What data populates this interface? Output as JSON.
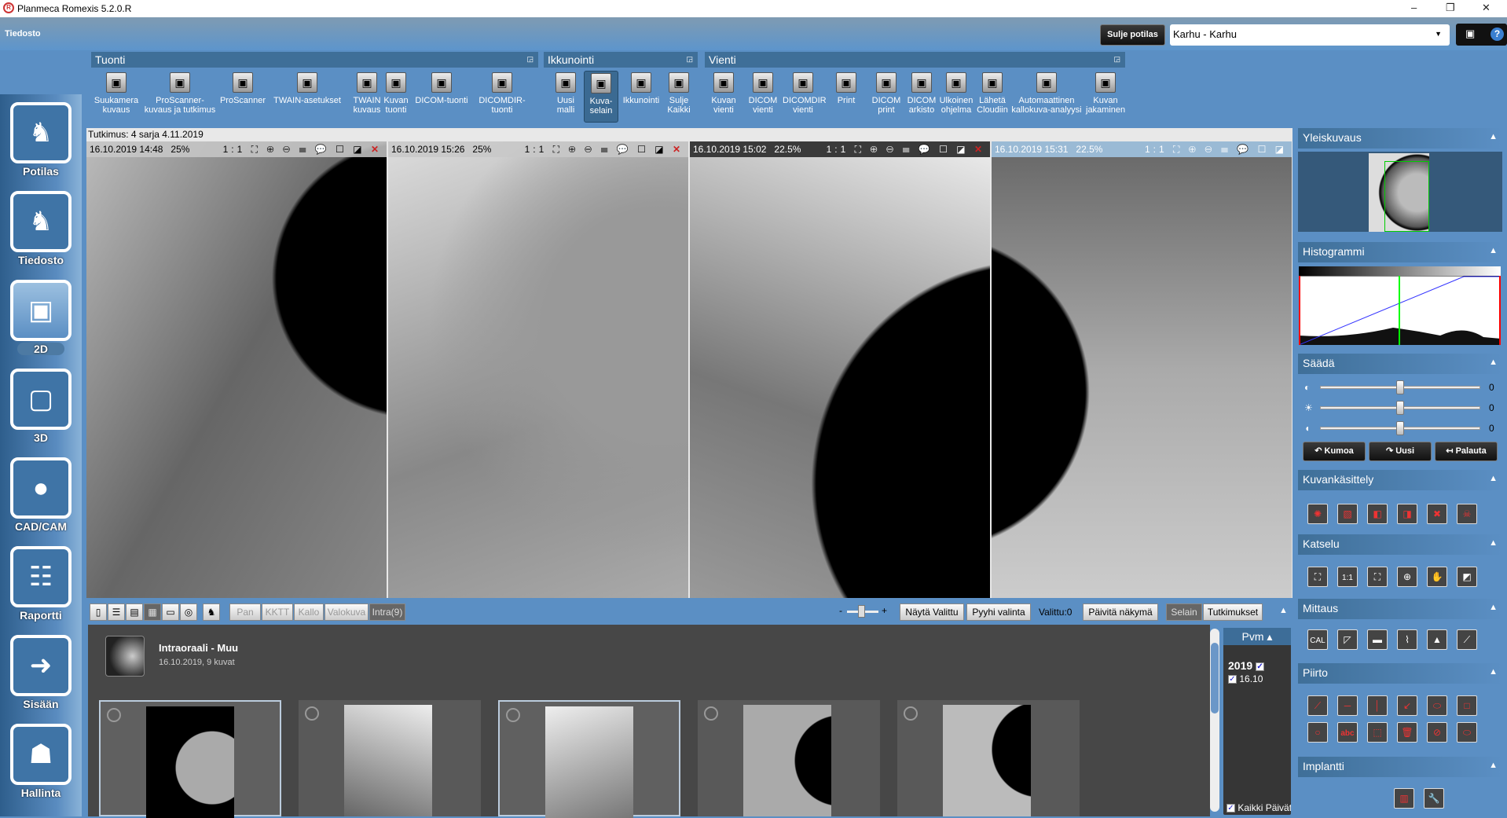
{
  "window": {
    "title": "Planmeca Romexis 5.2.0.R",
    "controls": [
      "–",
      "❐",
      "✕"
    ]
  },
  "menu": {
    "file": "Tiedosto"
  },
  "header": {
    "close_patient": "Sulje potilas",
    "patient": "Karhu - Karhu"
  },
  "ribbon": {
    "groups": [
      {
        "title": "Tuonti"
      },
      {
        "title": "Ikkunointi"
      },
      {
        "title": "Vienti"
      }
    ],
    "buttons": [
      {
        "label": "Suukamera kuvaus",
        "icon": "intraoral-camera-icon"
      },
      {
        "label": "ProScanner-kuvaus ja tutkimus",
        "icon": "scanner-icon"
      },
      {
        "label": "ProScanner",
        "icon": "scanner-icon"
      },
      {
        "label": "TWAIN-asetukset",
        "icon": "twain-settings-icon"
      },
      {
        "label": "TWAIN kuvaus",
        "icon": "twain-icon"
      },
      {
        "label": "Kuvan tuonti",
        "icon": "import-icon"
      },
      {
        "label": "DICOM-tuonti",
        "icon": "dicom-import-icon"
      },
      {
        "label": "DICOMDIR-tuonti",
        "icon": "dicomdir-import-icon"
      },
      {
        "label": "Uusi malli",
        "icon": "new-layout-icon"
      },
      {
        "label": "Kuva-selain",
        "icon": "image-browser-icon",
        "selected": true
      },
      {
        "label": "Ikkunointi",
        "icon": "windowing-icon"
      },
      {
        "label": "Sulje Kaikki",
        "icon": "close-all-icon"
      },
      {
        "label": "Kuvan vienti",
        "icon": "export-icon"
      },
      {
        "label": "DICOM vienti",
        "icon": "dicom-export-icon"
      },
      {
        "label": "DICOMDIR vienti",
        "icon": "dicomdir-export-icon"
      },
      {
        "label": "Print",
        "icon": "print-icon"
      },
      {
        "label": "DICOM print",
        "icon": "dicom-print-icon"
      },
      {
        "label": "DICOM arkisto",
        "icon": "dicom-archive-icon"
      },
      {
        "label": "Ulkoinen ohjelma",
        "icon": "external-program-icon"
      },
      {
        "label": "Lähetä Cloudiin",
        "icon": "cloud-upload-icon"
      },
      {
        "label": "Automaattinen kallokuva-analyysi",
        "icon": "ceph-analysis-icon"
      },
      {
        "label": "Kuvan jakaminen",
        "icon": "share-icon"
      }
    ]
  },
  "sidebar": {
    "items": [
      {
        "label": "Potilas"
      },
      {
        "label": "Tiedosto"
      },
      {
        "label": "2D",
        "active": true
      },
      {
        "label": "3D"
      },
      {
        "label": "CAD/CAM"
      },
      {
        "label": "Raportti"
      },
      {
        "label": "Sisään"
      },
      {
        "label": "Hallinta"
      }
    ]
  },
  "study": {
    "label": "Tutkimus: 4 sarja  4.11.2019"
  },
  "viewports": [
    {
      "date": "16.10.2019 14:48",
      "zoom": "25%",
      "tools": "1:1 ⛶ ⊕ ⊖ ☰ 💬 ☐ ◪"
    },
    {
      "date": "16.10.2019 15:26",
      "zoom": "25%",
      "tools": "1:1 ⛶ ⊕ ⊖ ☰ 💬 ☐ ◪"
    },
    {
      "date": "16.10.2019 15:02",
      "zoom": "22.5%",
      "tools": "1:1 ⛶ ⊕ ⊖ ☰ 💬 ☐ ◪",
      "active": true
    },
    {
      "date": "16.10.2019 15:31",
      "zoom": "22.5%",
      "tools": "1:1 ⛶ ⊕ ⊖ ☰ 💬 ☐ ◪"
    }
  ],
  "bottombar": {
    "filters": [
      "Pan",
      "KKTT",
      "Kallo",
      "Valokuva",
      "Intra(9)"
    ],
    "active_filter": "Intra(9)",
    "slider_minus": "-",
    "slider_plus": "+",
    "show_selected": "Näytä Valittu",
    "clear_selection": "Pyyhi valinta",
    "selected_count": "Valittu:0",
    "refresh": "Päivitä näkymä",
    "browser": "Selain",
    "studies": "Tutkimukset"
  },
  "browser": {
    "study_name": "Intraoraali - Muu",
    "study_info": "16.10.2019, 9 kuvat"
  },
  "date_panel": {
    "header": "Pvm",
    "year": "2019",
    "date": "16.10",
    "all_days": "Kaikki Päivät"
  },
  "right_panel": {
    "overview": "Yleiskuvaus",
    "histogram": "Histogrammi",
    "adjust": "Säädä",
    "sliders": [
      {
        "icon": "contrast-icon",
        "value": "0"
      },
      {
        "icon": "brightness-icon",
        "value": "0"
      },
      {
        "icon": "gamma-icon",
        "value": "0"
      }
    ],
    "undo": "Kumoa",
    "redo": "Uusi",
    "reset": "Palauta",
    "processing": "Kuvankäsittely",
    "view": "Katselu",
    "measure": "Mittaus",
    "measure_cal": "CAL",
    "view_1to1": "1:1",
    "draw": "Piirto",
    "draw_text": "abc",
    "implant": "Implantti"
  },
  "colors": {
    "accent": "#5b8fc4",
    "panel_header": "#3f6f98",
    "histogram_line": "#3333ff",
    "histogram_marker": "#00ff00"
  }
}
